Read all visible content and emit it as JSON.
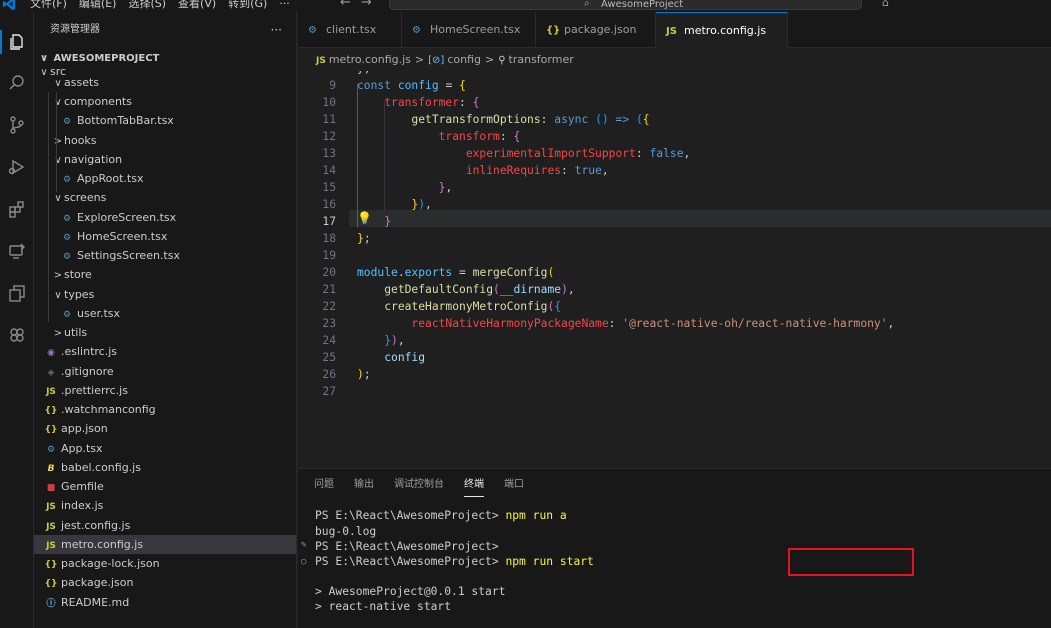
{
  "menu": [
    "文件(F)",
    "编辑(E)",
    "选择(S)",
    "查看(V)",
    "转到(G)",
    "···"
  ],
  "search": {
    "text": "AwesomeProject"
  },
  "sidebar": {
    "title": "资源管理器",
    "more": "···",
    "project": "AWESOMEPROJECT",
    "items": [
      {
        "label": "src",
        "type": "folder",
        "chev": "∨"
      },
      {
        "label": "assets",
        "type": "folder",
        "chev": "∨"
      },
      {
        "label": "components",
        "type": "folder",
        "chev": "∨"
      },
      {
        "label": "BottomTabBar.tsx",
        "type": "tsx"
      },
      {
        "label": "hooks",
        "type": "folder",
        "chev": ">"
      },
      {
        "label": "navigation",
        "type": "folder",
        "chev": "∨"
      },
      {
        "label": "AppRoot.tsx",
        "type": "tsx"
      },
      {
        "label": "screens",
        "type": "folder",
        "chev": "∨"
      },
      {
        "label": "ExploreScreen.tsx",
        "type": "tsx"
      },
      {
        "label": "HomeScreen.tsx",
        "type": "tsx"
      },
      {
        "label": "SettingsScreen.tsx",
        "type": "tsx"
      },
      {
        "label": "store",
        "type": "folder",
        "chev": ">"
      },
      {
        "label": "types",
        "type": "folder",
        "chev": "∨"
      },
      {
        "label": "user.tsx",
        "type": "tsx"
      },
      {
        "label": "utils",
        "type": "folder",
        "chev": ">"
      },
      {
        "label": ".eslintrc.js",
        "type": "eslint"
      },
      {
        "label": ".gitignore",
        "type": "git"
      },
      {
        "label": ".prettierrc.js",
        "type": "js"
      },
      {
        "label": ".watchmanconfig",
        "type": "json"
      },
      {
        "label": "app.json",
        "type": "json"
      },
      {
        "label": "App.tsx",
        "type": "tsx"
      },
      {
        "label": "babel.config.js",
        "type": "babel"
      },
      {
        "label": "Gemfile",
        "type": "ruby"
      },
      {
        "label": "index.js",
        "type": "js"
      },
      {
        "label": "jest.config.js",
        "type": "js"
      },
      {
        "label": "metro.config.js",
        "type": "js"
      },
      {
        "label": "package-lock.json",
        "type": "json"
      },
      {
        "label": "package.json",
        "type": "json"
      },
      {
        "label": "README.md",
        "type": "info"
      }
    ]
  },
  "tabs": [
    {
      "label": "client.tsx",
      "icon": "tsx"
    },
    {
      "label": "HomeScreen.tsx",
      "icon": "tsx"
    },
    {
      "label": "package.json",
      "icon": "json"
    },
    {
      "label": "metro.config.js",
      "icon": "js",
      "close": "✕"
    }
  ],
  "breadcrumb": {
    "file": "metro.config.js",
    "symbol1": "config",
    "symbol2": "transformer"
  },
  "editor": {
    "line_numbers": [
      "9",
      "10",
      "11",
      "12",
      "13",
      "14",
      "15",
      "16",
      "17",
      "18",
      "19",
      "20",
      "21",
      "22",
      "23",
      "24",
      "25",
      "26",
      "27"
    ],
    "current_line": "17"
  },
  "panel": {
    "tabs": [
      "问题",
      "输出",
      "调试控制台",
      "终端",
      "端口"
    ],
    "active_tab": "终端",
    "terminal": {
      "l1_prompt": "PS E:\\React\\AwesomeProject> ",
      "l1_cmd": "npm run a",
      "l2": "bug-0.log",
      "l3": "PS E:\\React\\AwesomeProject>",
      "l4_prompt": "PS E:\\React\\AwesomeProject> ",
      "l4_cmd": "npm run start",
      "l5": "> AwesomeProject@0.0.1 start",
      "l6": "> react-native start"
    }
  },
  "colors": {
    "accent": "#0078d4",
    "highlight_box": "#e81123",
    "js_icon": "#cbcb41",
    "tsx_icon": "#519aba"
  }
}
